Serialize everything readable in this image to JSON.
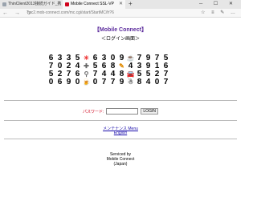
{
  "browser": {
    "tabs": [
      {
        "label": "ThinClient2013接続ガイド_携"
      },
      {
        "label": "Mobile Connect SSL-VP"
      }
    ],
    "new_tab": "+",
    "window_buttons": "─ ☐ ✕",
    "nav_buttons": "← → ↻",
    "url": "pc2.mob-connect.com/mc.cgi/start/StartMC/fr?6",
    "tools": "☆ ≡ ✎ …"
  },
  "page": {
    "title": "【Mobile Connect】",
    "subtitle": "＜ログイン画面＞",
    "grid": [
      [
        "6",
        "3",
        "3",
        "5",
        "sun",
        "6",
        "3",
        "0",
        "9",
        "cup",
        "7",
        "9",
        "7",
        "5"
      ],
      [
        "7",
        "0",
        "2",
        "4",
        "plus",
        "5",
        "6",
        "8",
        "pen",
        "4",
        "3",
        "9",
        "1",
        "6"
      ],
      [
        "5",
        "2",
        "7",
        "6",
        "search",
        "7",
        "4",
        "4",
        "8",
        "car",
        "5",
        "5",
        "2",
        "7"
      ],
      [
        "0",
        "6",
        "9",
        "0",
        "beer",
        "0",
        "7",
        "7",
        "9",
        "snow",
        "8",
        "4",
        "0",
        "7"
      ]
    ],
    "icons": {
      "sun": {
        "glyph": "☀",
        "color": "ic-red"
      },
      "cup": {
        "glyph": "☕",
        "color": "ic-green"
      },
      "plus": {
        "glyph": "✚",
        "color": "ic-gray"
      },
      "pen": {
        "glyph": "✎",
        "color": "ic-orange"
      },
      "search": {
        "glyph": "⚲",
        "color": "ic-gray"
      },
      "car": {
        "glyph": "🚘",
        "color": "ic-blue"
      },
      "beer": {
        "glyph": "🍺",
        "color": "ic-orange"
      },
      "snow": {
        "glyph": "☃",
        "color": "ic-gray"
      }
    },
    "password_label": "パスワード:",
    "password_value": "",
    "login_button": "LOGIN",
    "maintenance_link": "メンテナンス Menu",
    "english_link": "English",
    "footer_line1": "Serviced by",
    "footer_line2": "Mobile Connect",
    "footer_line3": "(Japan)"
  }
}
